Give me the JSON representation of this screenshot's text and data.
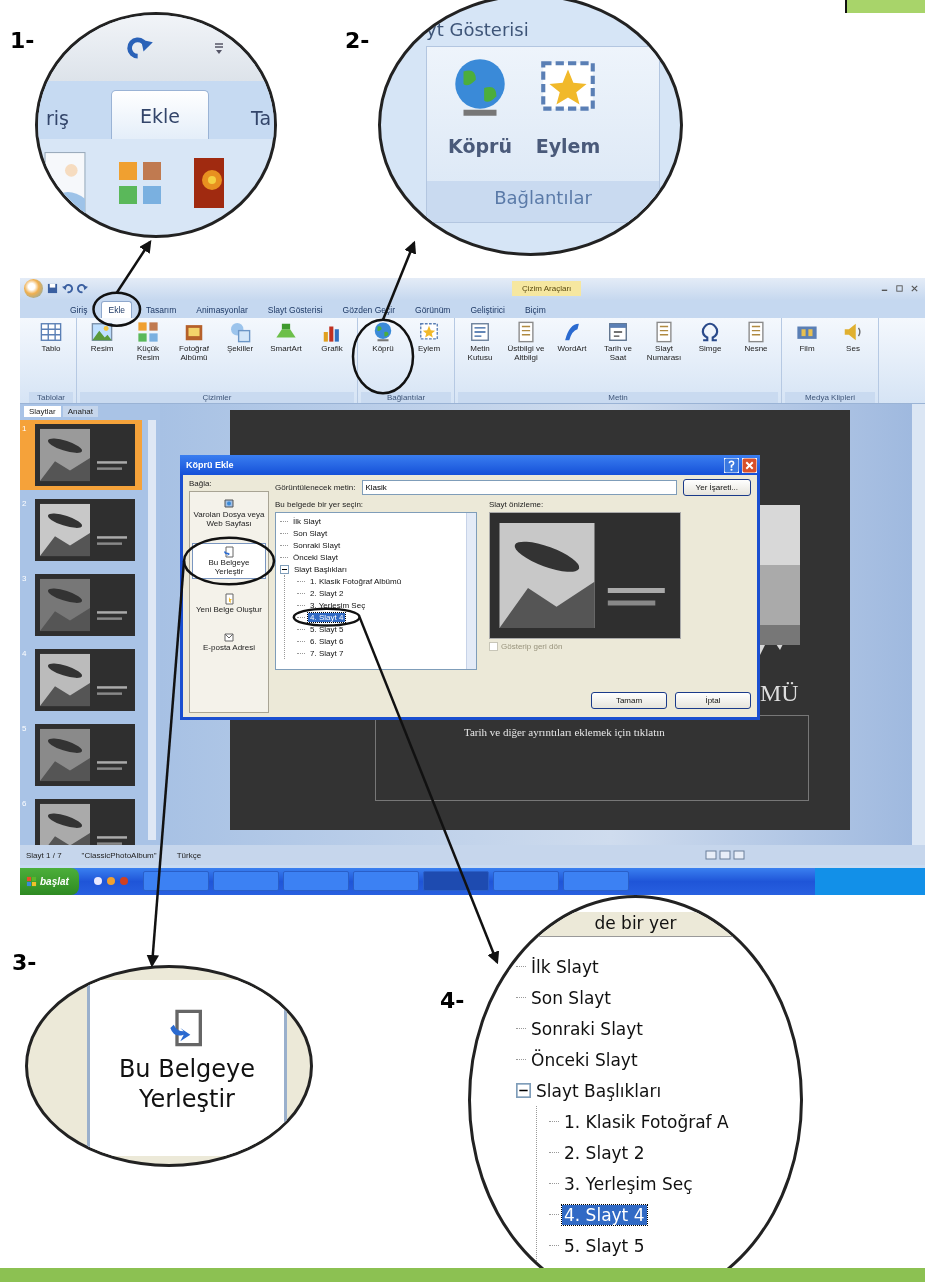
{
  "callout_1": {
    "label": "1-",
    "tabs": [
      {
        "label": "riş",
        "selected": false
      },
      {
        "label": "Ekle",
        "selected": true
      },
      {
        "label": "Ta",
        "selected": false
      }
    ]
  },
  "callout_2": {
    "label": "2-",
    "tab_title": "yt Gösterisi",
    "buttons": [
      {
        "label": "Köprü"
      },
      {
        "label": "Eylem"
      }
    ],
    "group": "Bağlantılar"
  },
  "callout_3": {
    "label": "3-",
    "button": "Bu Belgeye Yerleştir"
  },
  "callout_4": {
    "label": "4-",
    "header": "de bir yer",
    "tree": [
      {
        "label": "İlk Slayt",
        "selected": false
      },
      {
        "label": "Son Slayt",
        "selected": false
      },
      {
        "label": "Sonraki Slayt",
        "selected": false
      },
      {
        "label": "Önceki Slayt",
        "selected": false
      },
      {
        "label": "Slayt Başlıkları",
        "selected": false,
        "expanded": true,
        "children": [
          {
            "label": "1. Klasik Fotoğraf A",
            "selected": false
          },
          {
            "label": "2. Slayt 2",
            "selected": false
          },
          {
            "label": "3. Yerleşim Seç",
            "selected": false
          },
          {
            "label": "4. Slayt 4",
            "selected": true
          },
          {
            "label": "5. Slayt 5",
            "selected": false
          }
        ]
      }
    ]
  },
  "app": {
    "contextual_tab": "Çizim Araçları",
    "tabs": [
      {
        "label": "Giriş",
        "selected": false
      },
      {
        "label": "Ekle",
        "selected": true
      },
      {
        "label": "Tasarım",
        "selected": false
      },
      {
        "label": "Animasyonlar",
        "selected": false
      },
      {
        "label": "Slayt Gösterisi",
        "selected": false
      },
      {
        "label": "Gözden Geçir",
        "selected": false
      },
      {
        "label": "Görünüm",
        "selected": false
      },
      {
        "label": "Geliştirici",
        "selected": false
      },
      {
        "label": "Biçim",
        "selected": false
      }
    ],
    "ribbon_groups": [
      {
        "label": "Tablolar",
        "buttons": [
          {
            "label": "Tablo"
          }
        ]
      },
      {
        "label": "Çizimler",
        "buttons": [
          {
            "label": "Resim"
          },
          {
            "label": "Küçük Resim"
          },
          {
            "label": "Fotoğraf Albümü"
          },
          {
            "label": "Şekiller"
          },
          {
            "label": "SmartArt"
          },
          {
            "label": "Grafik"
          }
        ]
      },
      {
        "label": "Bağlantılar",
        "buttons": [
          {
            "label": "Köprü"
          },
          {
            "label": "Eylem"
          }
        ]
      },
      {
        "label": "Metin",
        "buttons": [
          {
            "label": "Metin Kutusu"
          },
          {
            "label": "Üstbilgi ve Altbilgi"
          },
          {
            "label": "WordArt"
          },
          {
            "label": "Tarih ve Saat"
          },
          {
            "label": "Slayt Numarası"
          },
          {
            "label": "Simge"
          },
          {
            "label": "Nesne"
          }
        ]
      },
      {
        "label": "Medya Klipleri",
        "buttons": [
          {
            "label": "Film"
          },
          {
            "label": "Ses"
          }
        ]
      }
    ],
    "panel_tabs": [
      {
        "label": "Slaytlar",
        "selected": true
      },
      {
        "label": "Anahat",
        "selected": false
      }
    ],
    "thumbnails": [
      {
        "number": "1",
        "selected": true
      },
      {
        "number": "2",
        "selected": false
      },
      {
        "number": "3",
        "selected": false
      },
      {
        "number": "4",
        "selected": false
      },
      {
        "number": "5",
        "selected": false
      },
      {
        "number": "6",
        "selected": false
      }
    ],
    "slide": {
      "title_fragment": "MÜ",
      "caption": "Tarih ve diğer ayrıntıları eklemek için tıklatın"
    },
    "dialog": {
      "title": "Köprü Ekle",
      "link_label": "Bağla:",
      "places": [
        {
          "label": "Varolan Dosya veya Web Sayfası",
          "selected": false
        },
        {
          "label": "Bu Belgeye Yerleştir",
          "selected": true
        },
        {
          "label": "Yeni Belge Oluştur",
          "selected": false
        },
        {
          "label": "E-posta Adresi",
          "selected": false
        }
      ],
      "display_text_label": "Görüntülenecek metin:",
      "display_text": "Klasik",
      "bookmark_button": "Yer İşareti...",
      "tree_label": "Bu belgede bir yer seçin:",
      "tree": [
        {
          "label": "İlk Slayt",
          "selected": false
        },
        {
          "label": "Son Slayt",
          "selected": false
        },
        {
          "label": "Sonraki Slayt",
          "selected": false
        },
        {
          "label": "Önceki Slayt",
          "selected": false
        },
        {
          "label": "Slayt Başlıkları",
          "selected": false,
          "expanded": true,
          "children": [
            {
              "label": "1. Klasik Fotoğraf Albümü",
              "selected": false
            },
            {
              "label": "2. Slayt 2",
              "selected": false
            },
            {
              "label": "3. Yerleşim Seç",
              "selected": false
            },
            {
              "label": "4. Slayt 4",
              "selected": true
            },
            {
              "label": "5. Slayt 5",
              "selected": false
            },
            {
              "label": "6. Slayt 6",
              "selected": false
            },
            {
              "label": "7. Slayt 7",
              "selected": false
            }
          ]
        }
      ],
      "preview_label": "Slayt önizleme:",
      "return_checkbox": {
        "label": "Gösterip geri dön",
        "checked": false,
        "disabled": true
      },
      "buttons": [
        "Tamam",
        "İptal"
      ]
    },
    "status_bar": [
      "Slayt 1 / 7",
      "\"ClassicPhotoAlbum\"",
      "Türkçe"
    ],
    "taskbar": {
      "start": "başlat",
      "tasks": [
        {
          "selected": false
        },
        {
          "selected": false
        },
        {
          "selected": false
        },
        {
          "selected": false
        },
        {
          "selected": true
        },
        {
          "selected": false
        },
        {
          "selected": false
        }
      ]
    }
  }
}
